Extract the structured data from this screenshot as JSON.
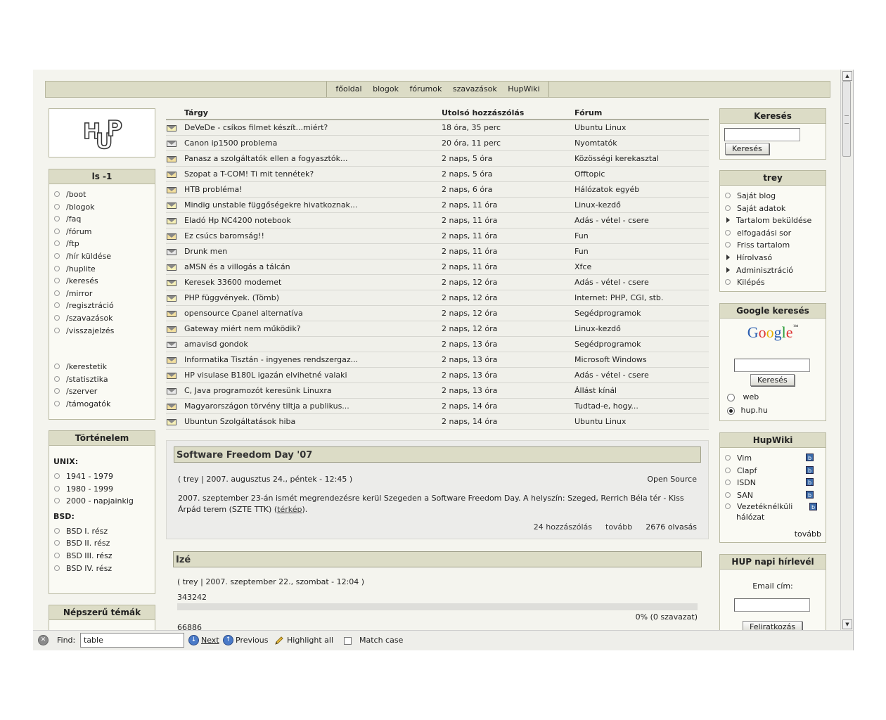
{
  "nav": {
    "links": [
      "főoldal",
      "blogok",
      "fórumok",
      "szavazások",
      "HupWiki"
    ]
  },
  "logo": {
    "text": "HUP"
  },
  "ls_box": {
    "title": "ls -1",
    "items_a": [
      "/boot",
      "/blogok",
      "/faq",
      "/fórum",
      "/ftp",
      "/hír küldése",
      "/huplite",
      "/keresés",
      "/mirror",
      "/regisztráció",
      "/szavazások",
      "/visszajelzés"
    ],
    "items_b": [
      "/kerestetik",
      "/statisztika",
      "/szerver",
      "/támogatók"
    ]
  },
  "history_box": {
    "title": "Történelem",
    "unix_label": "UNIX:",
    "unix_items": [
      "1941 - 1979",
      "1980 - 1999",
      "2000 - napjainkig"
    ],
    "bsd_label": "BSD:",
    "bsd_items": [
      "BSD I. rész",
      "BSD II. rész",
      "BSD III. rész",
      "BSD IV. rész"
    ]
  },
  "popular_box": {
    "title": "Népszerű témák"
  },
  "forum_table": {
    "headers": [
      "Tárgy",
      "Utolsó hozzászólás",
      "Fórum"
    ],
    "rows": [
      {
        "subject": "DeVeDe - csíkos filmet készít...miért?",
        "last": "18 óra, 35 perc",
        "forum": "Ubuntu Linux",
        "icon": "envelope-new"
      },
      {
        "subject": "Canon ip1500 problema",
        "last": "20 óra, 11 perc",
        "forum": "Nyomtatók",
        "icon": "envelope-read"
      },
      {
        "subject": "Panasz a szolgáltatók ellen a fogyasztók...",
        "last": "2 naps, 5 óra",
        "forum": "Közösségi kerekasztal",
        "icon": "envelope-hot"
      },
      {
        "subject": "Szopat a T-COM! Ti mit tennétek?",
        "last": "2 naps, 5 óra",
        "forum": "Offtopic",
        "icon": "envelope-hot"
      },
      {
        "subject": "HTB probléma!",
        "last": "2 naps, 6 óra",
        "forum": "Hálózatok egyéb",
        "icon": "envelope-hot"
      },
      {
        "subject": "Mindig unstable függőségekre hivatkoznak...",
        "last": "2 naps, 11 óra",
        "forum": "Linux-kezdő",
        "icon": "envelope-new"
      },
      {
        "subject": "Eladó Hp NC4200 notebook",
        "last": "2 naps, 11 óra",
        "forum": "Adás - vétel - csere",
        "icon": "envelope-new"
      },
      {
        "subject": "Ez csúcs baromság!!",
        "last": "2 naps, 11 óra",
        "forum": "Fun",
        "icon": "envelope-hot"
      },
      {
        "subject": "Drunk men",
        "last": "2 naps, 11 óra",
        "forum": "Fun",
        "icon": "envelope-read"
      },
      {
        "subject": "aMSN és a villogás a tálcán",
        "last": "2 naps, 11 óra",
        "forum": "Xfce",
        "icon": "envelope-new"
      },
      {
        "subject": "Keresek 33600 modemet",
        "last": "2 naps, 12 óra",
        "forum": "Adás - vétel - csere",
        "icon": "envelope-new"
      },
      {
        "subject": "PHP függvények. (Tömb)",
        "last": "2 naps, 12 óra",
        "forum": "Internet: PHP, CGI, stb.",
        "icon": "envelope-new"
      },
      {
        "subject": "opensource Cpanel alternatíva",
        "last": "2 naps, 12 óra",
        "forum": "Segédprogramok",
        "icon": "envelope-hot"
      },
      {
        "subject": "Gateway miért nem működik?",
        "last": "2 naps, 12 óra",
        "forum": "Linux-kezdő",
        "icon": "envelope-hot"
      },
      {
        "subject": "amavisd gondok",
        "last": "2 naps, 13 óra",
        "forum": "Segédprogramok",
        "icon": "envelope-read"
      },
      {
        "subject": "Informatika Tisztán - ingyenes rendszergaz...",
        "last": "2 naps, 13 óra",
        "forum": "Microsoft Windows",
        "icon": "envelope-hot"
      },
      {
        "subject": "HP visulase B180L igazán elvihetné valaki",
        "last": "2 naps, 13 óra",
        "forum": "Adás - vétel - csere",
        "icon": "envelope-hot"
      },
      {
        "subject": "C, Java programozót keresünk Linuxra",
        "last": "2 naps, 13 óra",
        "forum": "Állást kínál",
        "icon": "envelope-read"
      },
      {
        "subject": "Magyarországon törvény tiltja a publikus...",
        "last": "2 naps, 14 óra",
        "forum": "Tudtad-e, hogy...",
        "icon": "envelope-hot"
      },
      {
        "subject": "Ubuntun Szolgáltatások hiba",
        "last": "2 naps, 14 óra",
        "forum": "Ubuntu Linux",
        "icon": "envelope-new"
      }
    ]
  },
  "node1": {
    "title": "Software Freedom Day '07",
    "meta": "( trey | 2007. augusztus 24., péntek - 12:45 )",
    "category": "Open Source",
    "body_pre": "2007. szeptember 23-án ismét megrendezésre kerül Szegeden a Software Freedom Day. A helyszín: Szeged, Rerrich Béla tér - Kiss Árpád terem (SZTE TTK) (",
    "body_link": "térkép",
    "body_post": ").",
    "comments": "24 hozzászólás",
    "more": "tovább",
    "reads": "2676 olvasás"
  },
  "node2": {
    "title": "Izé",
    "meta": "( trey | 2007. szeptember 22., szombat - 12:04 )",
    "poll_option": "343242",
    "poll_result": "0% (0 szavazat)",
    "poll_option2": "66886",
    "poll_percent": 0
  },
  "search_box": {
    "title": "Keresés",
    "button": "Keresés",
    "value": ""
  },
  "user_box": {
    "title": "trey",
    "items": [
      {
        "label": "Saját blog",
        "bullet": "circle"
      },
      {
        "label": "Saját adatok",
        "bullet": "circle"
      },
      {
        "label": "Tartalom beküldése",
        "bullet": "arrow"
      },
      {
        "label": "elfogadási sor",
        "bullet": "circle"
      },
      {
        "label": "Friss tartalom",
        "bullet": "circle"
      },
      {
        "label": "Hírolvasó",
        "bullet": "arrow"
      },
      {
        "label": "Adminisztráció",
        "bullet": "arrow"
      },
      {
        "label": "Kilépés",
        "bullet": "circle"
      }
    ]
  },
  "google_box": {
    "title": "Google keresés",
    "logo": "Google",
    "button": "Keresés",
    "radio_web": "web",
    "radio_site": "hup.hu",
    "selected": "hup.hu"
  },
  "wiki_box": {
    "title": "HupWiki",
    "items": [
      "Vim",
      "Clapf",
      "ISDN",
      "SAN",
      "Vezetéknélküli hálózat"
    ],
    "more": "tovább"
  },
  "newsletter_box": {
    "title": "HUP napi hírlevél",
    "label": "Email cím:",
    "button": "Feliratkozás"
  },
  "findbar": {
    "find_label": "Find:",
    "query": "table",
    "next": "Next",
    "previous": "Previous",
    "highlight": "Highlight all",
    "match_case": "Match case"
  }
}
